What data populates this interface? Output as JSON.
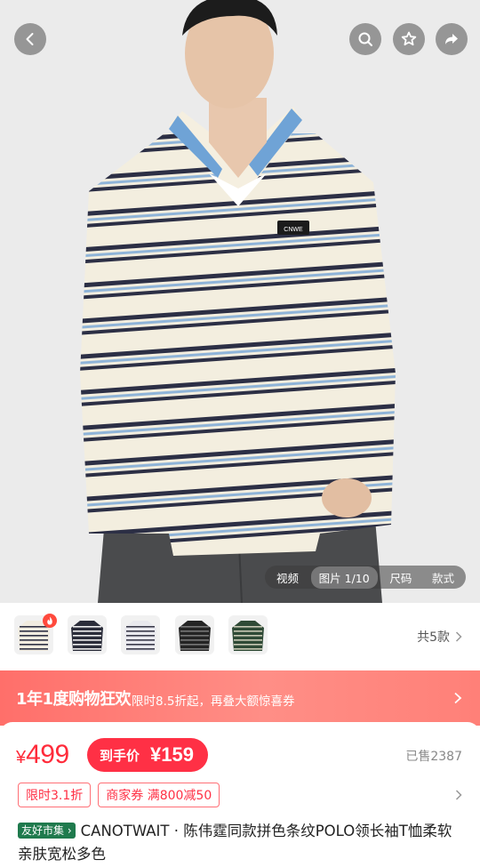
{
  "header": {
    "back_icon": "chevron-left-icon",
    "search_icon": "search-icon",
    "favorite_icon": "star-icon",
    "share_icon": "share-icon"
  },
  "media_tabs": [
    {
      "label": "视频"
    },
    {
      "label": "图片 1/10"
    },
    {
      "label": "尺码"
    },
    {
      "label": "款式"
    }
  ],
  "thumbnails": {
    "items": [
      {
        "name": "stripe-cream",
        "main": "#f1ece0",
        "stripe": "#2f3144"
      },
      {
        "name": "stripe-navy",
        "main": "#2b2d3a",
        "stripe": "#f0f0f0"
      },
      {
        "name": "stripe-grey",
        "main": "#e9e9ee",
        "stripe": "#3a3a4a"
      },
      {
        "name": "stripe-black",
        "main": "#242424",
        "stripe": "#777777"
      },
      {
        "name": "stripe-green",
        "main": "#2f4a36",
        "stripe": "#c9c9b5"
      }
    ],
    "count_label": "共5款"
  },
  "promo": {
    "title": "1年1度购物狂欢",
    "description": "限时8.5折起，再叠大额惊喜券"
  },
  "price": {
    "currency": "¥",
    "original": "499",
    "final_label": "到手价",
    "final_value": "¥159",
    "sold": "已售2387"
  },
  "coupons": [
    {
      "label": "限时3.1折"
    },
    {
      "label": "商家券 满800减50"
    }
  ],
  "product": {
    "tag": "友好市集",
    "title": "CANOTWAIT · 陈伟霆同款拼色条纹POLO领长袖T恤柔软亲肤宽松多色"
  },
  "colors": {
    "accent": "#ff3045",
    "promo_start": "#ff6f6a",
    "tag_green": "#1f7a4d"
  }
}
